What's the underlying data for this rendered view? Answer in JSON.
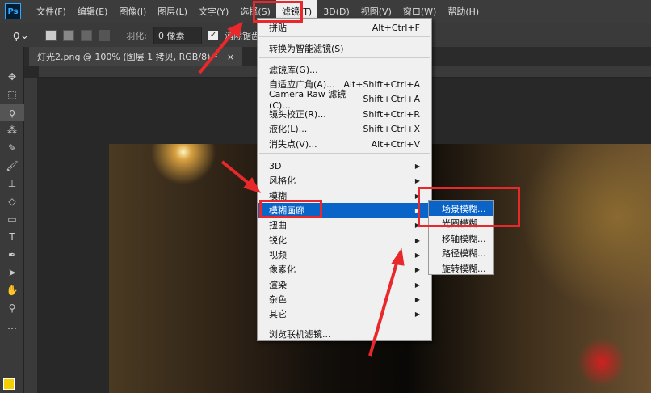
{
  "menubar": {
    "logo": "Ps",
    "items": [
      "文件(F)",
      "编辑(E)",
      "图像(I)",
      "图层(L)",
      "文字(Y)",
      "选择(S)",
      "滤镜(T)",
      "3D(D)",
      "视图(V)",
      "窗口(W)",
      "帮助(H)"
    ]
  },
  "options": {
    "feather_label": "羽化:",
    "feather_value": "0 像素",
    "antialias_label": "消除锯齿",
    "antialias_checked": true
  },
  "document_tab": {
    "title": "灯光2.png @ 100% (图层 1 拷贝, RGB/8) *",
    "close": "×"
  },
  "filter_menu": {
    "items": [
      {
        "label": "拼贴",
        "shortcut": "Alt+Ctrl+F"
      },
      {
        "label": "转换为智能滤镜(S)",
        "shortcut": ""
      },
      {
        "label": "滤镜库(G)...",
        "shortcut": ""
      },
      {
        "label": "自适应广角(A)...",
        "shortcut": "Alt+Shift+Ctrl+A"
      },
      {
        "label": "Camera Raw 滤镜(C)...",
        "shortcut": "Shift+Ctrl+A"
      },
      {
        "label": "镜头校正(R)...",
        "shortcut": "Shift+Ctrl+R"
      },
      {
        "label": "液化(L)...",
        "shortcut": "Shift+Ctrl+X"
      },
      {
        "label": "消失点(V)...",
        "shortcut": "Alt+Ctrl+V"
      },
      {
        "label": "3D",
        "shortcut": "▶"
      },
      {
        "label": "风格化",
        "shortcut": "▶"
      },
      {
        "label": "模糊",
        "shortcut": "▶"
      },
      {
        "label": "模糊画廊",
        "shortcut": "▶"
      },
      {
        "label": "扭曲",
        "shortcut": "▶"
      },
      {
        "label": "锐化",
        "shortcut": "▶"
      },
      {
        "label": "视频",
        "shortcut": "▶"
      },
      {
        "label": "像素化",
        "shortcut": "▶"
      },
      {
        "label": "渲染",
        "shortcut": "▶"
      },
      {
        "label": "杂色",
        "shortcut": "▶"
      },
      {
        "label": "其它",
        "shortcut": "▶"
      },
      {
        "label": "浏览联机滤镜...",
        "shortcut": ""
      }
    ]
  },
  "blur_gallery_submenu": {
    "items": [
      "场景模糊...",
      "光圈模糊...",
      "移轴模糊...",
      "路径模糊...",
      "旋转模糊..."
    ]
  },
  "colors": {
    "highlight": "#0a64c8",
    "annotation": "#e8282a"
  }
}
